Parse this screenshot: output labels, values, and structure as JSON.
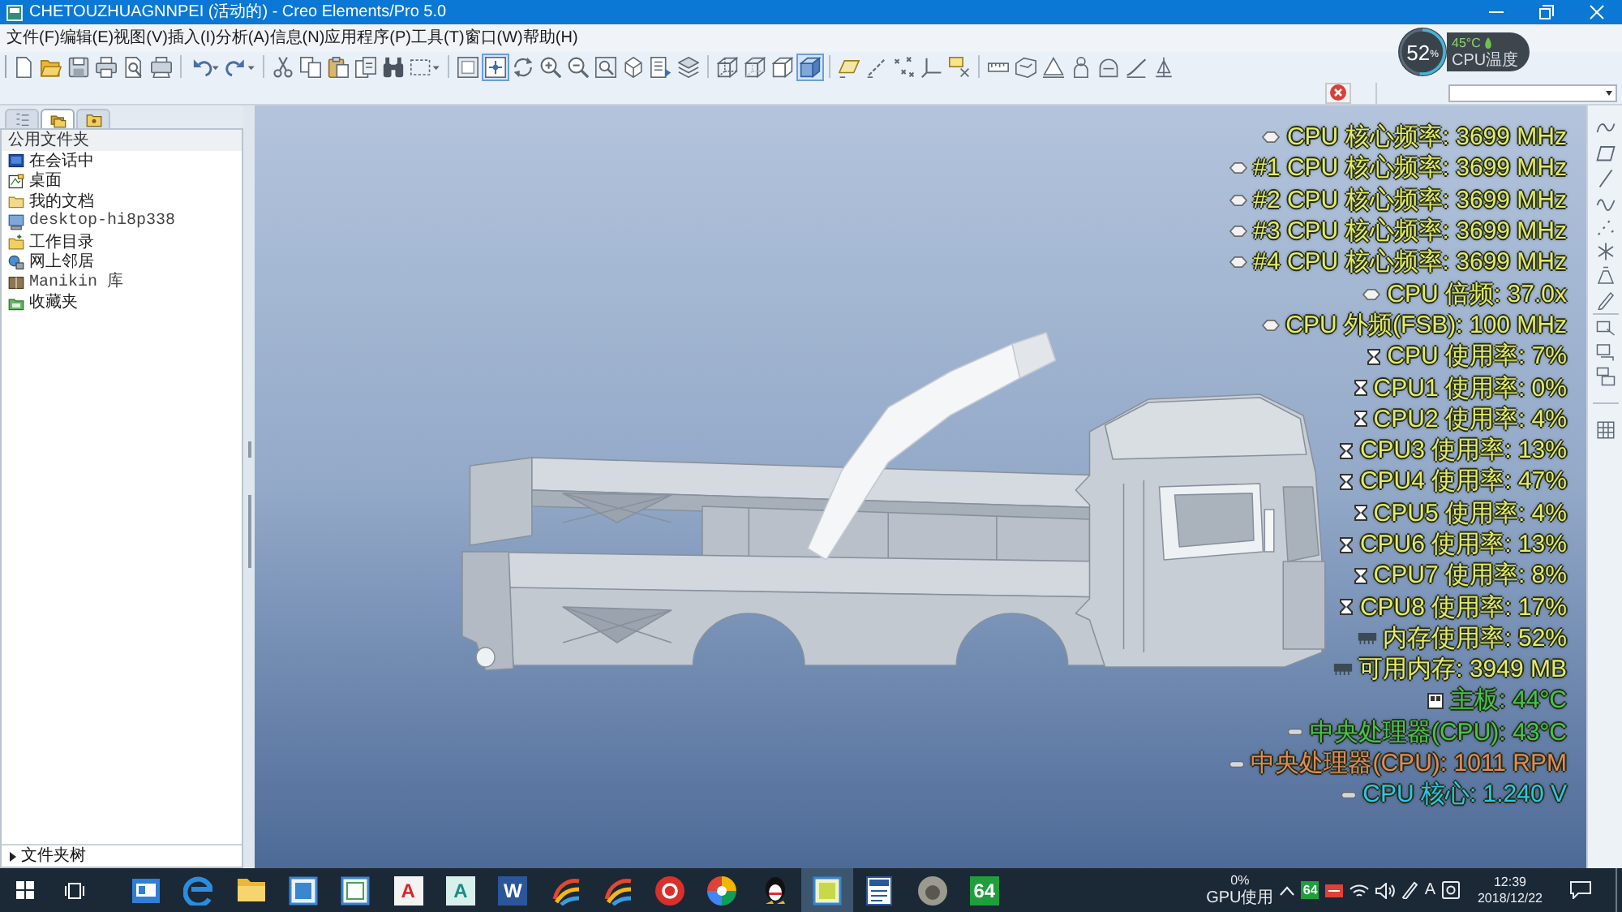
{
  "window": {
    "title": "CHETOUZHUAGNNPEI (活动的) - Creo Elements/Pro 5.0"
  },
  "menu": [
    "文件(F)",
    "编辑(E)",
    "视图(V)",
    "插入(I)",
    "分析(A)",
    "信息(N)",
    "应用程序(P)",
    "工具(T)",
    "窗口(W)",
    "帮助(H)"
  ],
  "toolbar": [
    [
      {
        "kind": "new",
        "selected": false
      },
      {
        "kind": "open",
        "selected": false
      },
      {
        "kind": "save",
        "selected": false
      },
      {
        "kind": "print",
        "selected": false
      },
      {
        "kind": "preview",
        "selected": false
      },
      {
        "kind": "send",
        "selected": false
      }
    ],
    [
      {
        "kind": "undo",
        "selected": false
      },
      {
        "kind": "redo",
        "selected": false
      }
    ],
    [
      {
        "kind": "cut",
        "selected": false
      },
      {
        "kind": "copy",
        "selected": false
      },
      {
        "kind": "paste",
        "selected": false
      },
      {
        "kind": "duplicate",
        "selected": false
      },
      {
        "kind": "find",
        "selected": false
      },
      {
        "kind": "select",
        "selected": false
      }
    ],
    [
      {
        "kind": "repaint",
        "selected": false
      },
      {
        "kind": "spin",
        "selected": true
      },
      {
        "kind": "orient",
        "selected": false
      },
      {
        "kind": "zoomin",
        "selected": false
      },
      {
        "kind": "zoomout",
        "selected": false
      },
      {
        "kind": "refit",
        "selected": false
      },
      {
        "kind": "view",
        "selected": false
      },
      {
        "kind": "saved",
        "selected": false
      },
      {
        "kind": "layers",
        "selected": false
      }
    ],
    [
      {
        "kind": "wireframe",
        "selected": false
      },
      {
        "kind": "hidden",
        "selected": false
      },
      {
        "kind": "nohidden",
        "selected": false
      },
      {
        "kind": "shaded",
        "selected": true
      }
    ],
    [
      {
        "kind": "planes",
        "selected": false
      },
      {
        "kind": "axes",
        "selected": false
      },
      {
        "kind": "points",
        "selected": false
      },
      {
        "kind": "csys",
        "selected": false
      },
      {
        "kind": "tags",
        "selected": false
      }
    ],
    [
      {
        "kind": "measure",
        "selected": false
      },
      {
        "kind": "shell",
        "selected": false
      },
      {
        "kind": "draft",
        "selected": false
      },
      {
        "kind": "mannequin",
        "selected": false
      },
      {
        "kind": "round",
        "selected": false
      },
      {
        "kind": "sweep",
        "selected": false
      },
      {
        "kind": "rib",
        "selected": false
      }
    ]
  ],
  "cpu_monitor": {
    "value": "52",
    "unit": "%",
    "level": 0.52,
    "temperature": "45°C",
    "label": "CPU温度"
  },
  "navigator": {
    "tabs": [
      {
        "kind": "tree",
        "selected": false
      },
      {
        "kind": "folders",
        "selected": true
      },
      {
        "kind": "favorites",
        "selected": false
      }
    ],
    "header": "公用文件夹",
    "items": [
      {
        "kind": "session",
        "label": "在会话中"
      },
      {
        "kind": "desktop",
        "label": "桌面"
      },
      {
        "kind": "documents",
        "label": "我的文档"
      },
      {
        "kind": "computer",
        "label": "desktop-hi8p338"
      },
      {
        "kind": "workdir",
        "label": "工作目录"
      },
      {
        "kind": "network",
        "label": "网上邻居"
      },
      {
        "kind": "library",
        "label": "Manikin 库"
      },
      {
        "kind": "favorites",
        "label": "收藏夹"
      }
    ],
    "folder_tree": {
      "label": "文件夹树",
      "expanded": false
    }
  },
  "sensor_overlay": [
    {
      "kind": "frequency",
      "text": "CPU 核心频率: 3699 MHz",
      "color": "#e3ec6a"
    },
    {
      "kind": "frequency",
      "text": "#1 CPU 核心频率: 3699 MHz",
      "color": "#e3ec6a"
    },
    {
      "kind": "frequency",
      "text": "#2 CPU 核心频率: 3699 MHz",
      "color": "#e3ec6a"
    },
    {
      "kind": "frequency",
      "text": "#3 CPU 核心频率: 3699 MHz",
      "color": "#e3ec6a"
    },
    {
      "kind": "frequency",
      "text": "#4 CPU 核心频率: 3699 MHz",
      "color": "#e3ec6a"
    },
    {
      "kind": "frequency",
      "text": "CPU 倍频: 37.0x",
      "color": "#e3ec6a"
    },
    {
      "kind": "frequency",
      "text": "CPU 外频(FSB): 100 MHz",
      "color": "#e3ec6a"
    },
    {
      "kind": "usage",
      "text": "CPU 使用率: 7%",
      "color": "#e3ec6a"
    },
    {
      "kind": "usage",
      "text": "CPU1 使用率: 0%",
      "color": "#e3ec6a"
    },
    {
      "kind": "usage",
      "text": "CPU2 使用率: 4%",
      "color": "#e3ec6a"
    },
    {
      "kind": "usage",
      "text": "CPU3 使用率: 13%",
      "color": "#e3ec6a"
    },
    {
      "kind": "usage",
      "text": "CPU4 使用率: 47%",
      "color": "#e3ec6a"
    },
    {
      "kind": "usage",
      "text": "CPU5 使用率: 4%",
      "color": "#e3ec6a"
    },
    {
      "kind": "usage",
      "text": "CPU6 使用率: 13%",
      "color": "#e3ec6a"
    },
    {
      "kind": "usage",
      "text": "CPU7 使用率: 8%",
      "color": "#e3ec6a"
    },
    {
      "kind": "usage",
      "text": "CPU8 使用率: 17%",
      "color": "#e3ec6a"
    },
    {
      "kind": "memory",
      "text": "内存使用率: 52%",
      "color": "#e3ec6a"
    },
    {
      "kind": "memory",
      "text": "可用内存: 3949 MB",
      "color": "#e3ec6a"
    },
    {
      "kind": "board",
      "text": "主板: 44°C",
      "color": "#43c453"
    },
    {
      "kind": "sensor",
      "text": "中央处理器(CPU): 43°C",
      "color": "#43c453"
    },
    {
      "kind": "sensor",
      "text": "中央处理器(CPU): 1011 RPM",
      "color": "#e08a5c"
    },
    {
      "kind": "sensor",
      "text": "CPU 核心: 1.240 V",
      "color": "#2cc6e6"
    }
  ],
  "taskbar": {
    "apps": [
      {
        "kind": "card",
        "selected": false
      },
      {
        "kind": "browser",
        "selected": false
      },
      {
        "kind": "folder",
        "selected": false
      },
      {
        "kind": "window",
        "selected": false
      },
      {
        "kind": "panel",
        "selected": false
      },
      {
        "kind": "cad",
        "label": "A",
        "selected": false
      },
      {
        "kind": "alias",
        "label": "A",
        "selected": false
      },
      {
        "kind": "word",
        "label": "W",
        "selected": false
      },
      {
        "kind": "swirl",
        "selected": false
      },
      {
        "kind": "swirl",
        "selected": false
      },
      {
        "kind": "disc",
        "selected": false
      },
      {
        "kind": "wheel",
        "selected": false
      },
      {
        "kind": "penguin",
        "selected": false
      },
      {
        "kind": "note",
        "selected": true
      },
      {
        "kind": "document",
        "selected": false
      },
      {
        "kind": "round",
        "selected": false
      },
      {
        "kind": "aida",
        "label": "64",
        "selected": false
      }
    ],
    "gpu": {
      "value": "0%",
      "label": "GPU使用"
    },
    "tray": [
      {
        "kind": "chevron"
      },
      {
        "kind": "badge",
        "label": "64"
      },
      {
        "kind": "flag"
      },
      {
        "kind": "network"
      },
      {
        "kind": "volume"
      },
      {
        "kind": "pen"
      },
      {
        "kind": "ime",
        "label": "A"
      },
      {
        "kind": "input"
      }
    ],
    "clock": {
      "time": "12:39",
      "date": "2018/12/22"
    }
  }
}
